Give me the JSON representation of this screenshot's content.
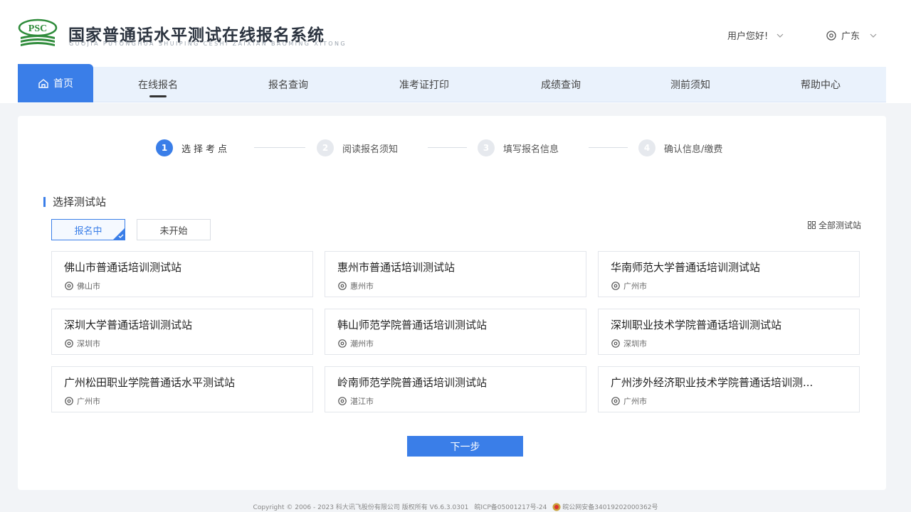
{
  "header": {
    "logo_text": "PSC",
    "title": "国家普通话水平测试在线报名系统",
    "subtitle": "GUOJIA PUTONGHUA SHUIPING CESHI ZAIXIAN BAOMING XITONG",
    "user_greeting": "用户您好!",
    "region": "广东"
  },
  "nav": {
    "home": "首页",
    "items": [
      "在线报名",
      "报名查询",
      "准考证打印",
      "成绩查询",
      "测前须知",
      "帮助中心"
    ]
  },
  "steps": [
    {
      "num": "1",
      "label": "选择考点"
    },
    {
      "num": "2",
      "label": "阅读报名须知"
    },
    {
      "num": "3",
      "label": "填写报名信息"
    },
    {
      "num": "4",
      "label": "确认信息/缴费"
    }
  ],
  "section": {
    "title": "选择测试站",
    "tabs": [
      "报名中",
      "未开始"
    ],
    "all_stations": "全部测试站"
  },
  "stations": [
    {
      "name": "佛山市普通话培训测试站",
      "city": "佛山市"
    },
    {
      "name": "惠州市普通话培训测试站",
      "city": "惠州市"
    },
    {
      "name": "华南师范大学普通话培训测试站",
      "city": "广州市"
    },
    {
      "name": "深圳大学普通话培训测试站",
      "city": "深圳市"
    },
    {
      "name": "韩山师范学院普通话培训测试站",
      "city": "潮州市"
    },
    {
      "name": "深圳职业技术学院普通话培训测试站",
      "city": "深圳市"
    },
    {
      "name": "广州松田职业学院普通话水平测试站",
      "city": "广州市"
    },
    {
      "name": "岭南师范学院普通话培训测试站",
      "city": "湛江市"
    },
    {
      "name": "广州涉外经济职业技术学院普通话培训测...",
      "city": "广州市"
    }
  ],
  "actions": {
    "next": "下一步"
  },
  "footer": {
    "copyright": "Copyright © 2006 - 2023 科大讯飞股份有限公司 版权所有 V6.6.3.0301",
    "icp": "皖ICP备05001217号-24",
    "police": "皖公网安备34019202000362号"
  },
  "colors": {
    "primary": "#3a7ee8",
    "nav_bg": "#eaf2fc",
    "logo_green": "#2e8b3a"
  }
}
